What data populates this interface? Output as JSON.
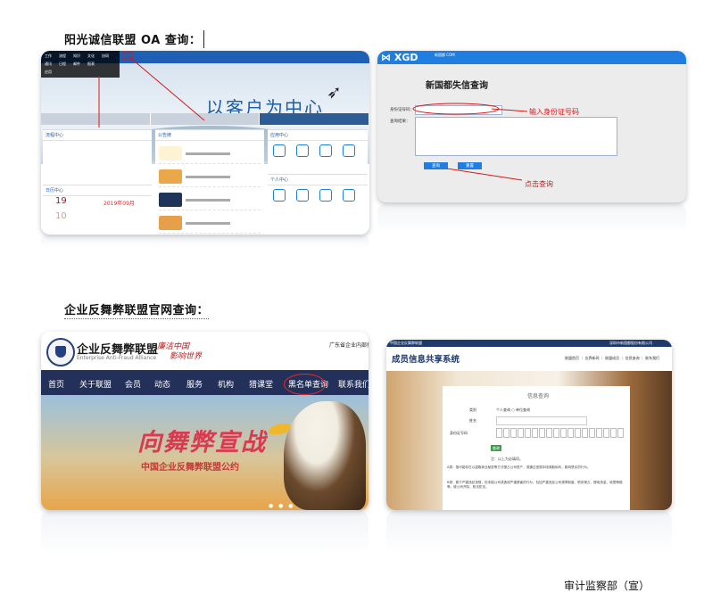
{
  "headings": {
    "oa": "阳光诚信联盟 OA 查询：",
    "alliance": "企业反舞弊联盟官网查询："
  },
  "oa_screenshot": {
    "slogan": "以客户为中心",
    "menu_items": [
      "工作",
      "流程",
      "知识",
      "文化",
      "协同",
      "通讯",
      "日程",
      "邮件",
      "报表",
      "应用"
    ],
    "panels": [
      "流程中心",
      "公告牌",
      "应用中心",
      "日历中心",
      "个人中心"
    ],
    "date_day": "19",
    "date_next": "10",
    "date_text": "2019年09月"
  },
  "xgd_screenshot": {
    "logo": "XGD",
    "logo_sub": "新国都 COM",
    "title": "新国都失信查询",
    "id_label": "身份证号码：",
    "result_label": "查询结果：",
    "query_button": "查询",
    "reset_button": "重置",
    "annotation_id": "输入身份证号码",
    "annotation_query": "点击查询"
  },
  "alliance_screenshot": {
    "org_name": "企业反舞弊联盟",
    "org_name_en": "Enterprise Anti-Fraud Alliance",
    "motto_line1": "廉洁中国",
    "motto_line2": "影响世界",
    "top_right": "广东省企业内部控",
    "nav": [
      "首页",
      "关于联盟",
      "会员",
      "动态",
      "服务",
      "机构",
      "猎课堂",
      "黑名单查询",
      "联系我们"
    ],
    "slogan": "向舞弊宣战",
    "subtitle": "中国企业反舞弊联盟公约"
  },
  "member_screenshot": {
    "top_left": "中国企业反舞弊联盟",
    "top_right": "深圳市新国都股份有限公司",
    "title": "成员信息共享系统",
    "nav": "联盟首页 ｜ 业界新闻 ｜ 联盟成员 ｜ 信息查询 ｜ 联系我们",
    "card_title": "信息查询",
    "type_label": "类别",
    "type_value": "个人查询 ○ 单位查询",
    "name_label": "姓名",
    "id_label": "身份证号码",
    "query_button": "查询",
    "note": "注：以上为必填项。",
    "para1": "A类：指可能存在以盗取商业秘密等方式侵占公司资产，或通过违规手段谋取私利，影响恶劣的行为。",
    "para2": "B类：属于严重违纪违规，但未能公司或造成严重侵害的行为，包括严重违反公司规章制度、职务侵占、挪用资金、收受贿赂等，被公司开除，知法犯法。"
  },
  "footer": "审计监察部（宣）"
}
